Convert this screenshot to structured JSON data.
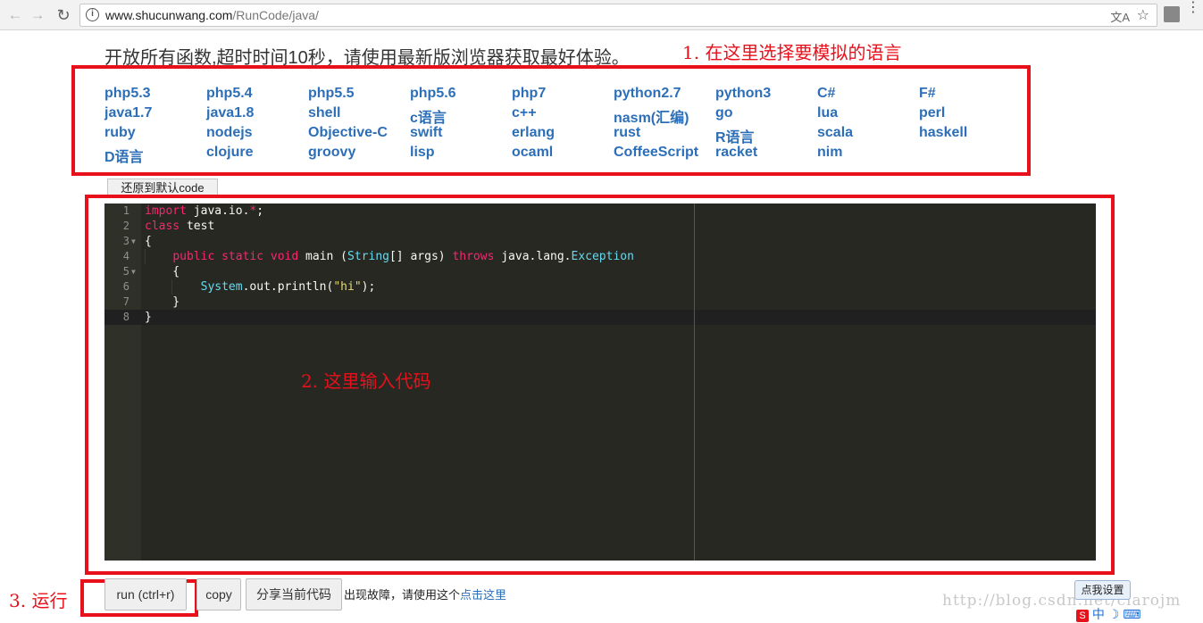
{
  "browser": {
    "url_host": "www.shucunwang.com",
    "url_path": "/RunCode/java/",
    "translate_icon": "translate-icon",
    "star_icon": "star-icon"
  },
  "page": {
    "notice": "开放所有函数,超时时间10秒，请使用最新版浏览器获取最好体验。"
  },
  "annotations": {
    "step1": "1. 在这里选择要模拟的语言",
    "step2": "2. 这里输入代码",
    "step3": "3. 运行"
  },
  "languages": [
    [
      "php5.3",
      "php5.4",
      "php5.5",
      "php5.6",
      "php7",
      "python2.7",
      "python3",
      "C#",
      "F#"
    ],
    [
      "java1.7",
      "java1.8",
      "shell",
      "c语言",
      "c++",
      "nasm(汇编)",
      "go",
      "lua",
      "perl"
    ],
    [
      "ruby",
      "nodejs",
      "Objective-C",
      "swift",
      "erlang",
      "rust",
      "R语言",
      "scala",
      "haskell"
    ],
    [
      "D语言",
      "clojure",
      "groovy",
      "lisp",
      "ocaml",
      "CoffeeScript",
      "racket",
      "nim"
    ]
  ],
  "reset_button": "还原到默认code",
  "editor": {
    "line_numbers": [
      "1",
      "2",
      "3",
      "4",
      "5",
      "6",
      "7",
      "8"
    ]
  },
  "bottom": {
    "run_button": "run (ctrl+r)",
    "copy_button": "copy",
    "share_button": "分享当前代码",
    "fault_text": "出现故障，请使用这个",
    "fault_link": "点击这里",
    "settings_button": "点我设置",
    "watermark": "http://blog.csdn.net/clarojm"
  },
  "colors": {
    "annotation_red": "#e8111b",
    "link_blue": "#2c6fb8",
    "editor_bg": "#272822"
  }
}
